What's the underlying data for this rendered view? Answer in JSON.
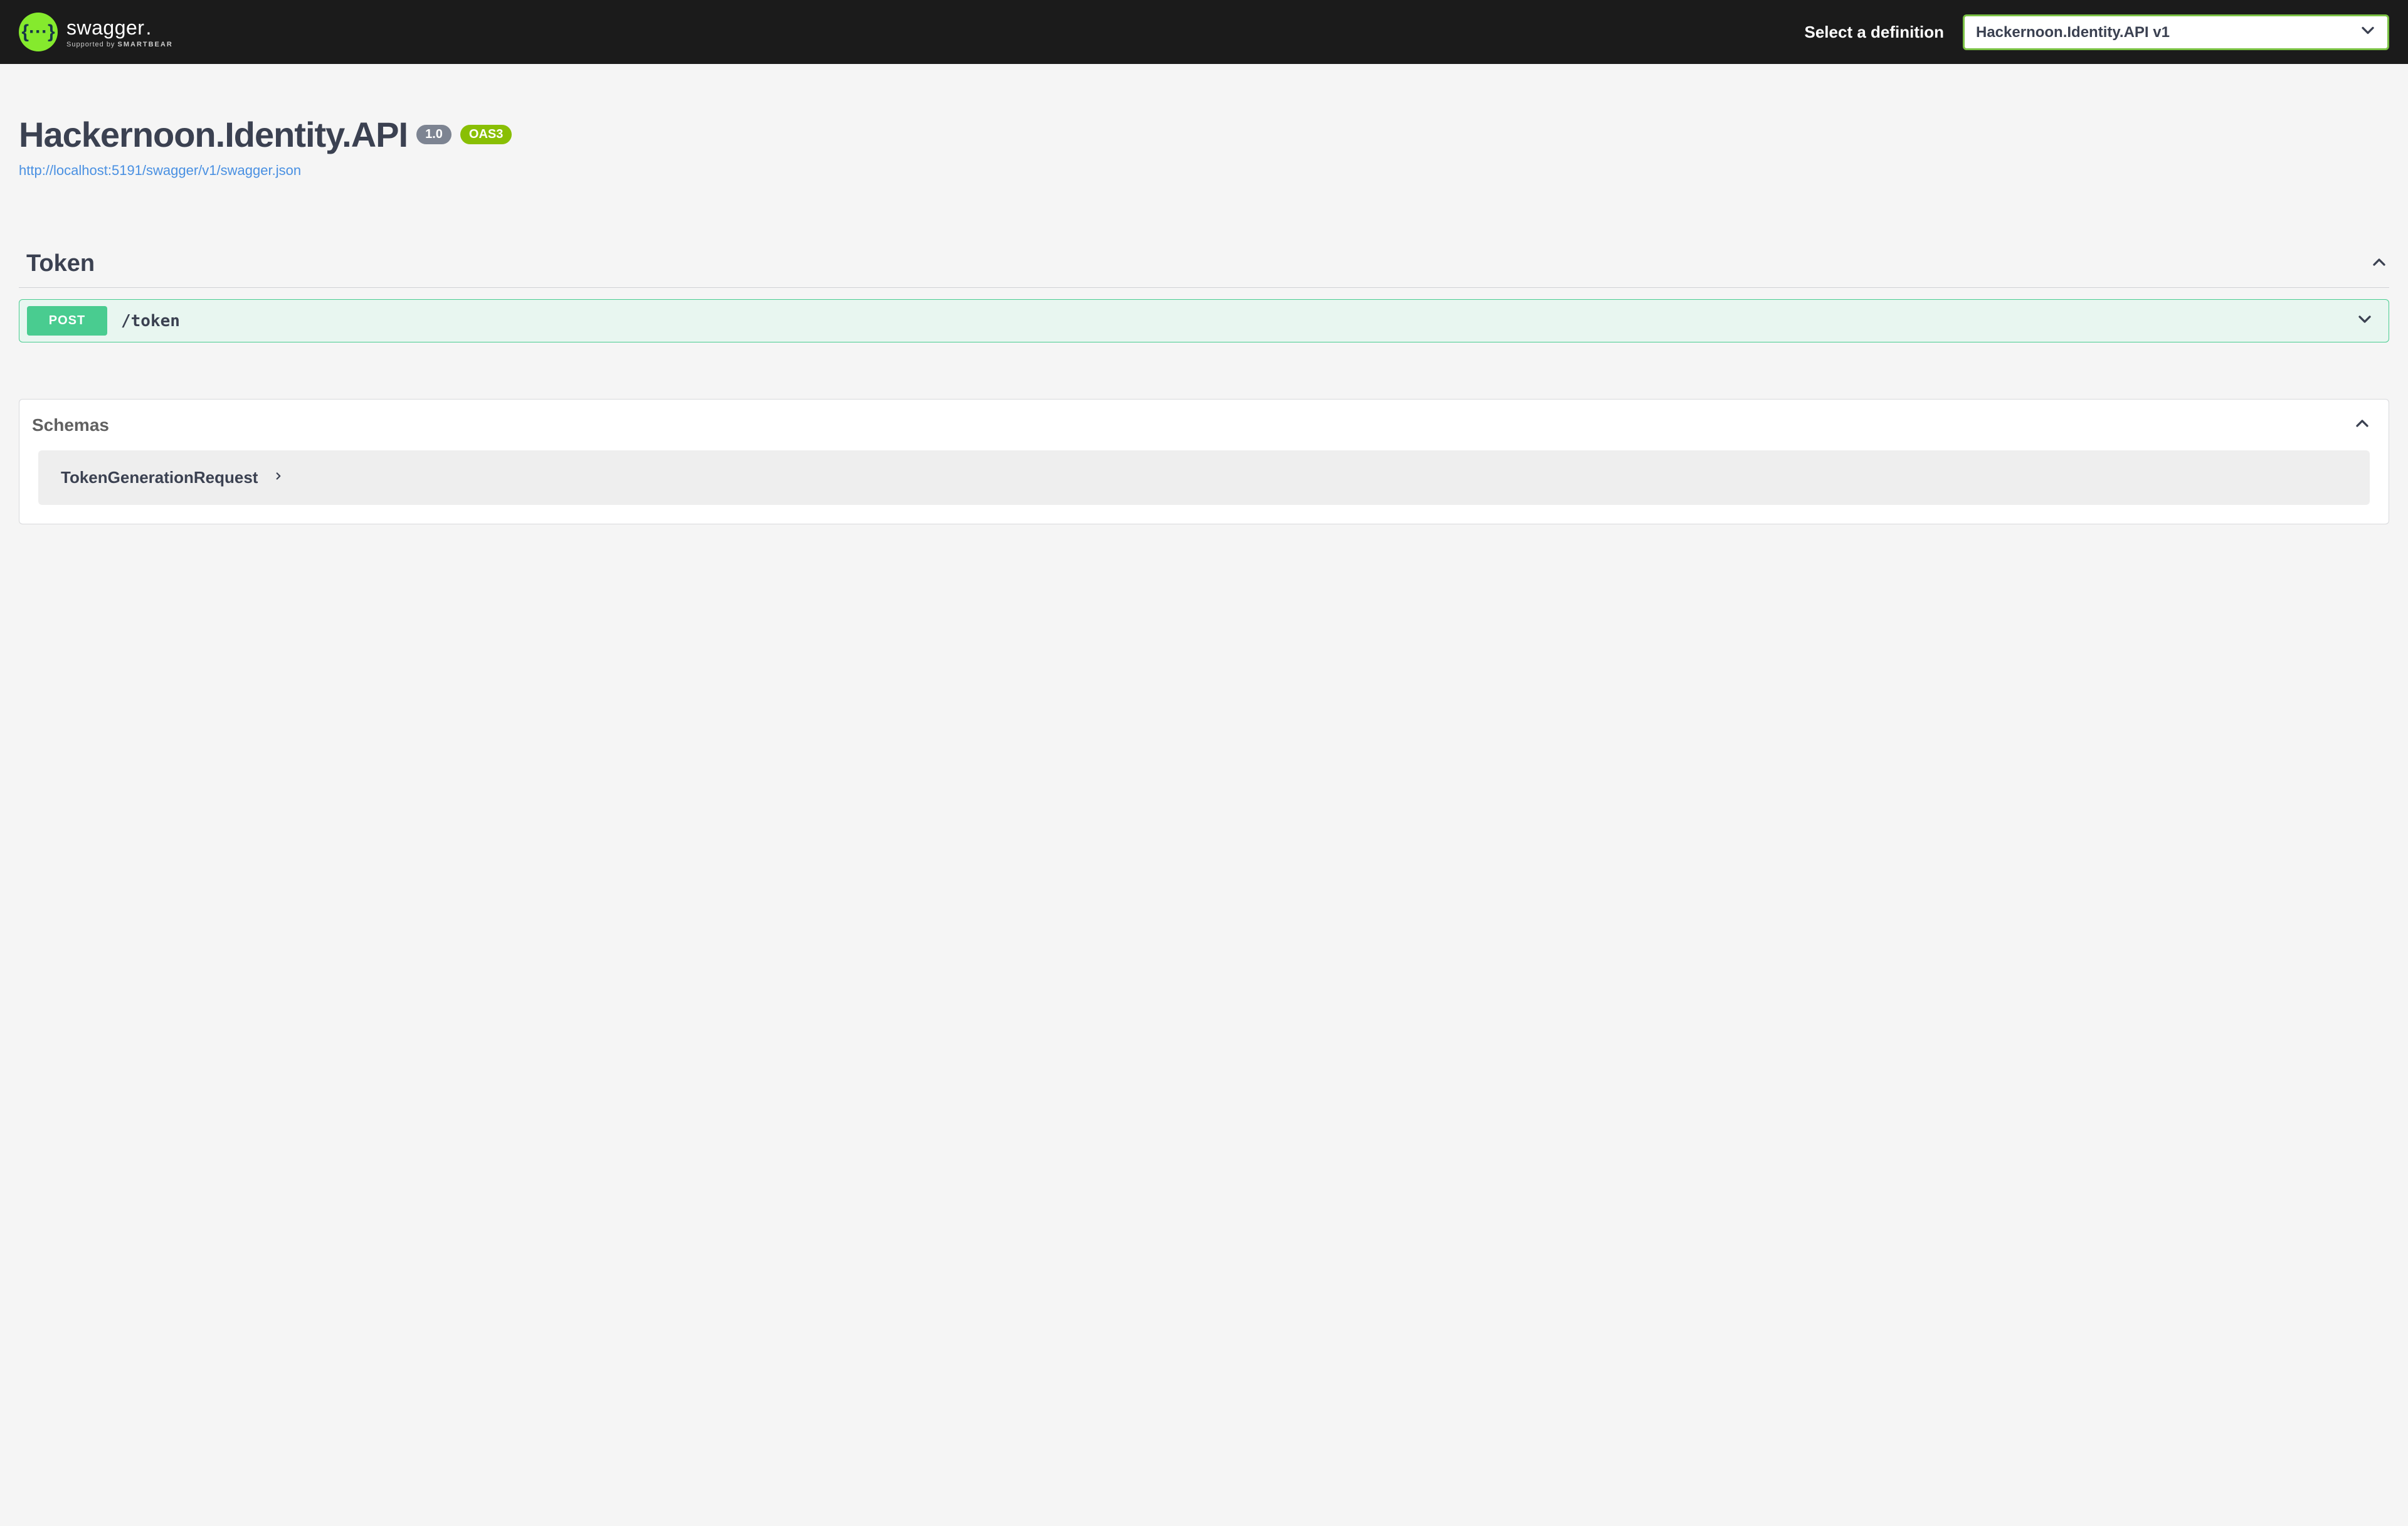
{
  "topbar": {
    "brand": "swagger",
    "tagline_prefix": "Supported by ",
    "tagline_strong": "SMARTBEAR",
    "select_label": "Select a definition",
    "selected_definition": "Hackernoon.Identity.API v1"
  },
  "info": {
    "title": "Hackernoon.Identity.API",
    "version": "1.0",
    "oas_badge": "OAS3",
    "spec_url": "http://localhost:5191/swagger/v1/swagger.json"
  },
  "tags": [
    {
      "name": "Token",
      "operations": [
        {
          "method": "POST",
          "path": "/token"
        }
      ]
    }
  ],
  "schemas": {
    "title": "Schemas",
    "items": [
      {
        "name": "TokenGenerationRequest"
      }
    ]
  }
}
